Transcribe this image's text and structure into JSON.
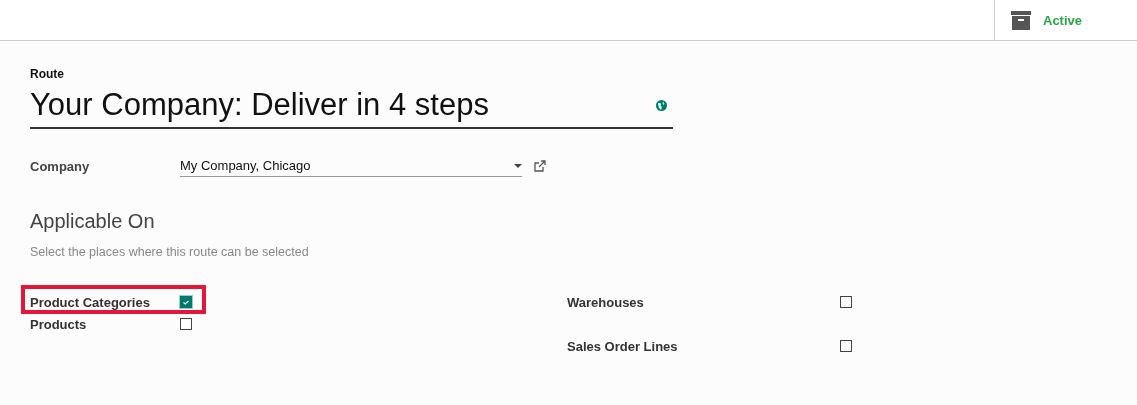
{
  "status_button": {
    "label": "Active"
  },
  "form": {
    "name_label": "Route",
    "name": "Your Company: Deliver in 4 steps",
    "company": {
      "label": "Company",
      "value": "My Company, Chicago"
    },
    "section": {
      "title": "Applicable On",
      "hint": "Select the places where this route can be selected"
    },
    "left_options": [
      {
        "label": "Product Categories",
        "checked": true,
        "highlighted": true
      },
      {
        "label": "Products",
        "checked": false,
        "highlighted": false
      }
    ],
    "right_options": [
      {
        "label": "Warehouses",
        "checked": false,
        "highlighted": false
      },
      {
        "label": "Sales Order Lines",
        "checked": false,
        "highlighted": false
      }
    ]
  }
}
